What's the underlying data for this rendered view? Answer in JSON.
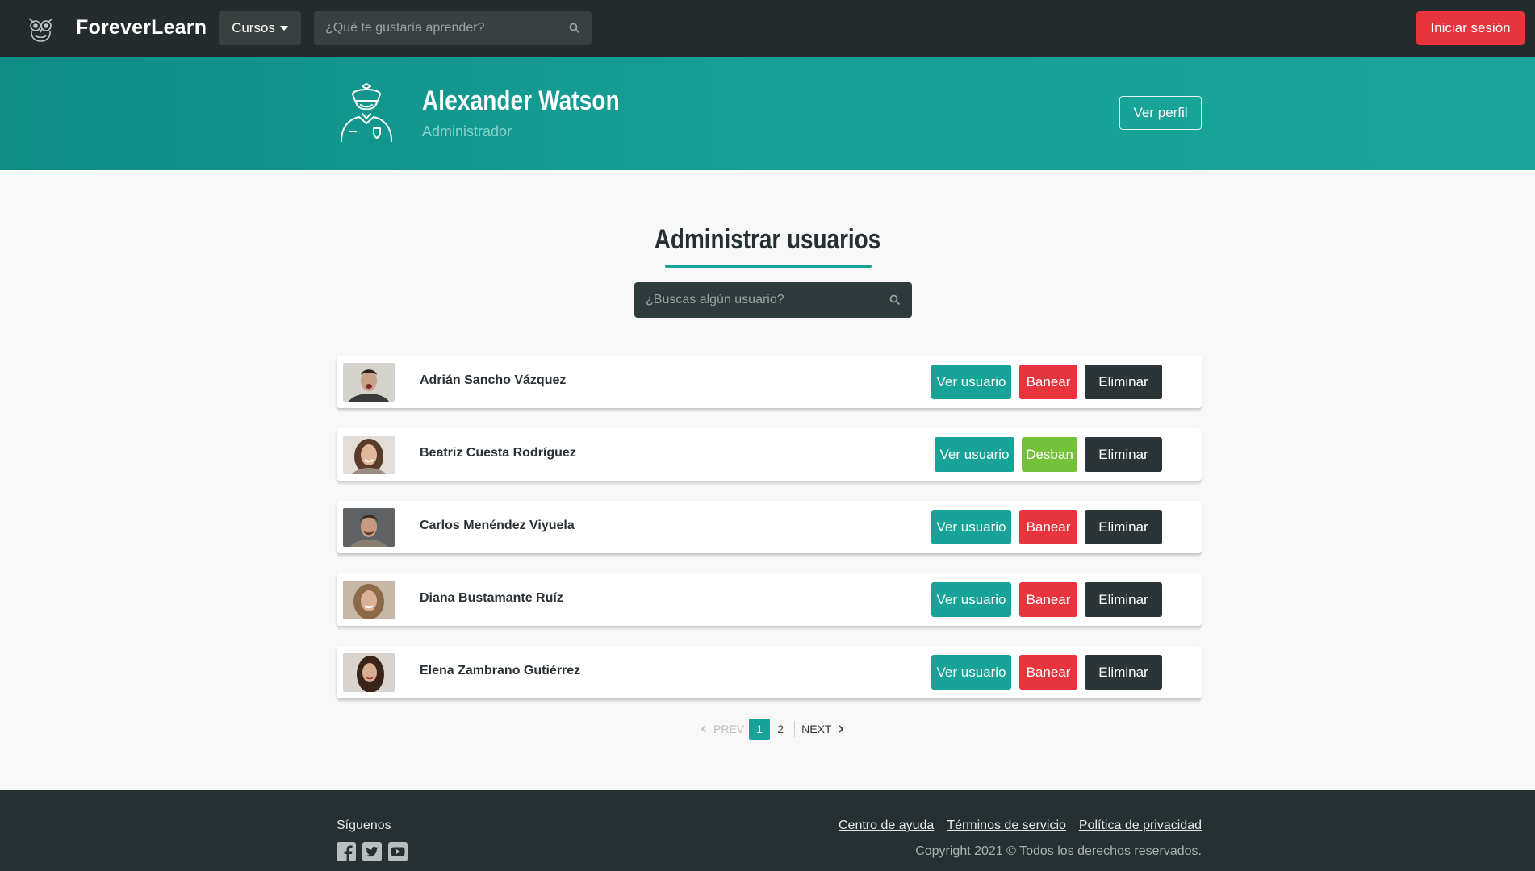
{
  "navbar": {
    "brand": "ForeverLearn",
    "courses_label": "Cursos",
    "search_placeholder": "¿Qué te gustaría aprender?",
    "login_label": "Iniciar sesión"
  },
  "hero": {
    "name": "Alexander Watson",
    "role": "Administrador",
    "profile_button": "Ver perfil"
  },
  "main": {
    "title": "Administrar usuarios",
    "search_placeholder": "¿Buscas algún usuario?",
    "users": [
      {
        "name": "Adrián Sancho Vázquez",
        "view": "Ver usuario",
        "ban": "Banear",
        "delete": "Eliminar",
        "banned": false
      },
      {
        "name": "Beatriz Cuesta Rodríguez",
        "view": "Ver usuario",
        "ban": "Desban",
        "delete": "Eliminar",
        "banned": true
      },
      {
        "name": "Carlos Menéndez Viyuela",
        "view": "Ver usuario",
        "ban": "Banear",
        "delete": "Eliminar",
        "banned": false
      },
      {
        "name": "Diana Bustamante Ruíz",
        "view": "Ver usuario",
        "ban": "Banear",
        "delete": "Eliminar",
        "banned": false
      },
      {
        "name": "Elena Zambrano Gutiérrez",
        "view": "Ver usuario",
        "ban": "Banear",
        "delete": "Eliminar",
        "banned": false
      }
    ]
  },
  "pagination": {
    "prev": "PREV",
    "pages": [
      "1",
      "2"
    ],
    "current": "1",
    "next": "NEXT"
  },
  "footer": {
    "follow_label": "Síguenos",
    "social": [
      "facebook-icon",
      "twitter-icon",
      "youtube-icon"
    ],
    "links": [
      "Centro de ayuda",
      "Términos de servicio",
      "Política de privacidad"
    ],
    "copyright": "Copyright 2021 © Todos los derechos reservados."
  },
  "colors": {
    "teal": "#17a398",
    "red": "#e8343d",
    "green": "#74c13a",
    "dark": "#232b2d"
  }
}
